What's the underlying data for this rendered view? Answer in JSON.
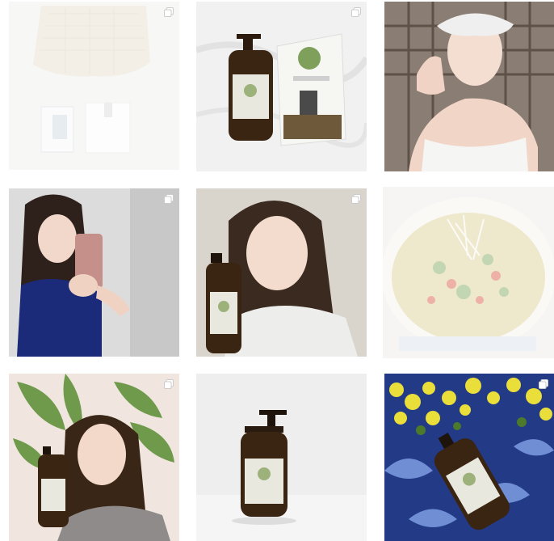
{
  "feed": {
    "posts": [
      {
        "label": "",
        "subject": "knit-top-and-skincare-box",
        "multi": true,
        "dimmed": true
      },
      {
        "label": "",
        "subject": "amber-pump-bottle-with-box",
        "multi": true,
        "dimmed": false
      },
      {
        "label": "",
        "subject": "woman-in-towel",
        "multi": false,
        "dimmed": false
      },
      {
        "label": "",
        "subject": "woman-mirror-selfie",
        "multi": true,
        "dimmed": false
      },
      {
        "label": "",
        "subject": "woman-holding-bottle",
        "multi": true,
        "dimmed": false
      },
      {
        "label": "",
        "subject": "noodle-salad-bowl",
        "multi": false,
        "dimmed": true
      },
      {
        "label": "",
        "subject": "woman-with-plant-holding-bottle",
        "multi": true,
        "dimmed": false
      },
      {
        "label": "",
        "subject": "amber-pump-bottle-plain",
        "multi": false,
        "dimmed": false
      },
      {
        "label": "",
        "subject": "bottle-with-yellow-flowers",
        "multi": true,
        "dimmed": false
      }
    ]
  },
  "colors": {
    "background": "#ffffff",
    "bottle": "#3a2412",
    "bottle_label": "#e9e8df",
    "leaf_green": "#6f9a4c"
  }
}
